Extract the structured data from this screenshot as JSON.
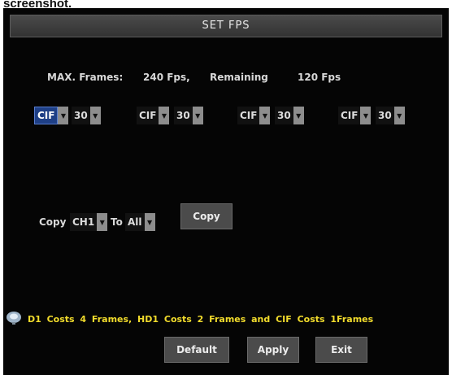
{
  "page_header": "screenshot.",
  "dialog": {
    "title": "SET FPS",
    "max_frames_label": "MAX. Frames:",
    "max_frames_value": "240 Fps,",
    "remaining_label": "Remaining",
    "remaining_value": "120 Fps"
  },
  "channels": [
    {
      "resolution": "CIF",
      "fps": "30"
    },
    {
      "resolution": "CIF",
      "fps": "30"
    },
    {
      "resolution": "CIF",
      "fps": "30"
    },
    {
      "resolution": "CIF",
      "fps": "30"
    }
  ],
  "copy": {
    "copy_label": "Copy",
    "from_value": "CH1",
    "to_label": "To",
    "to_value": "All",
    "button_label": "Copy"
  },
  "hint_text": "D1 Costs 4 Frames, HD1 Costs 2 Frames and CIF Costs 1Frames",
  "footer": {
    "default_label": "Default",
    "apply_label": "Apply",
    "exit_label": "Exit"
  },
  "colors": {
    "panel_bg": "#050505",
    "active_select": "#1e3f86",
    "hint_text": "#f2dc2c"
  },
  "icons": {
    "hint": "info-bulb-icon",
    "dropdown": "dropdown-arrow-icon"
  }
}
